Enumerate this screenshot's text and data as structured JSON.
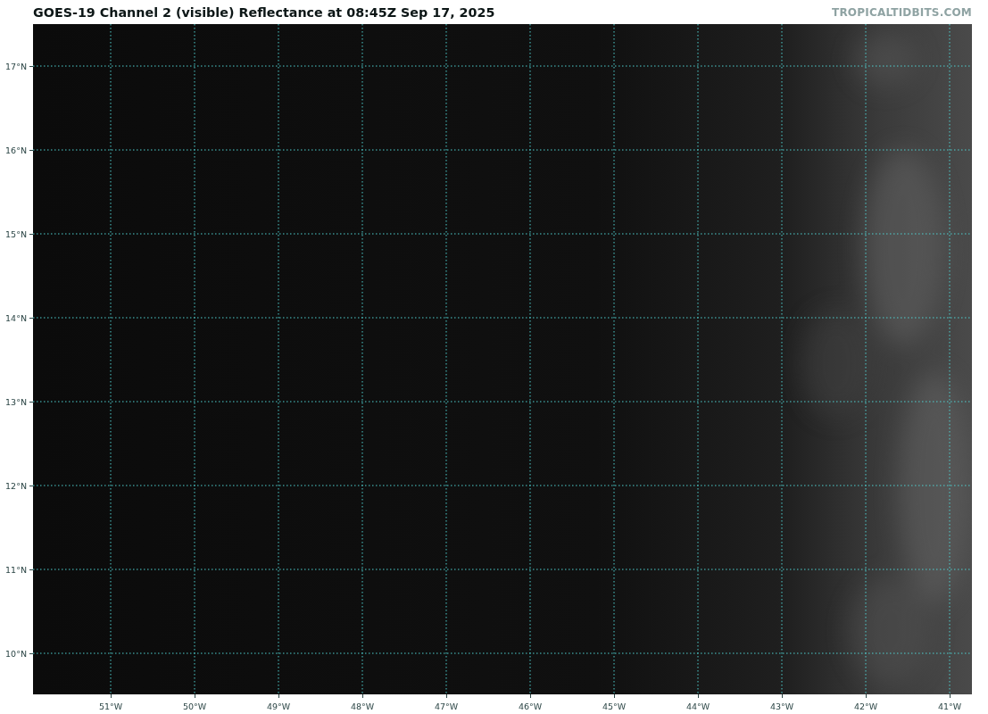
{
  "title": "GOES-19 Channel 2 (visible) Reflectance at 08:45Z Sep 17, 2025",
  "site_label": "TROPICALTIDBITS.COM",
  "map": {
    "latitude_labels": [
      "17°N",
      "16°N",
      "15°N",
      "14°N",
      "13°N",
      "12°N",
      "11°N",
      "10°N"
    ],
    "longitude_labels": [
      "51°W",
      "50°W",
      "49°W",
      "48°W",
      "47°W",
      "46°W",
      "45°W",
      "44°W",
      "43°W",
      "42°W",
      "41°W"
    ]
  }
}
